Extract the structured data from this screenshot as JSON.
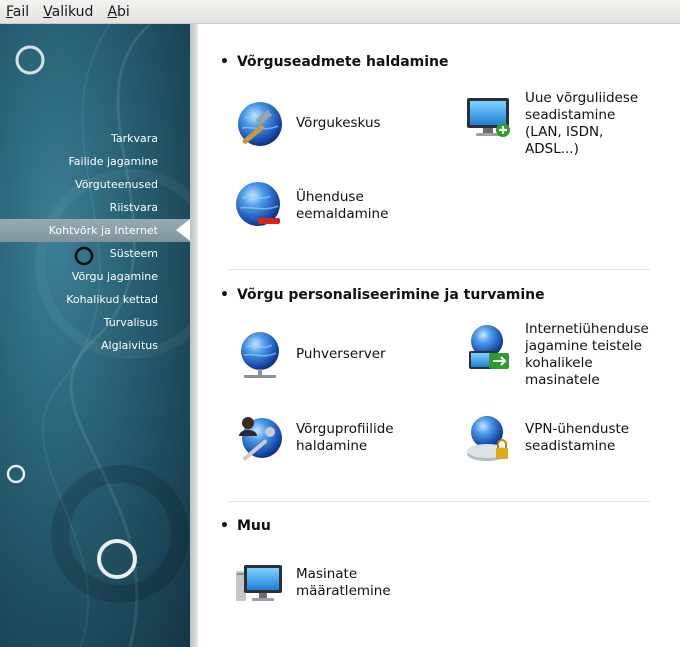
{
  "menubar": {
    "items": [
      {
        "mnemonic": "F",
        "rest": "ail"
      },
      {
        "mnemonic": "V",
        "rest": "alikud"
      },
      {
        "mnemonic": "A",
        "rest": "bi"
      }
    ]
  },
  "sidebar": {
    "items": [
      "Tarkvara",
      "Failide jagamine",
      "Võrguteenused",
      "Riistvara",
      "Kohtvõrk ja Internet",
      "Süsteem",
      "Võrgu jagamine",
      "Kohalikud kettad",
      "Turvalisus",
      "Alglaivitus"
    ],
    "active_index": 4
  },
  "sections": [
    {
      "title": "Võrguseadmete haldamine",
      "tools": [
        {
          "label": "Võrgukeskus",
          "icon": "network-center-icon"
        },
        {
          "label": "Uue võrguliidese\nseadistamine\n(LAN, ISDN,\nADSL...)",
          "icon": "new-interface-icon"
        },
        {
          "label": "Ühenduse\neemaldamine",
          "icon": "remove-connection-icon"
        }
      ]
    },
    {
      "title": "Võrgu personaliseerimine ja turvamine",
      "tools": [
        {
          "label": "Puhverserver",
          "icon": "proxy-icon"
        },
        {
          "label": "Internetiühenduse\njagamine teistele\nkohalikele\nmasinatele",
          "icon": "share-connection-icon"
        },
        {
          "label": "Võrguprofiilide\nhaldamine",
          "icon": "network-profiles-icon"
        },
        {
          "label": "VPN-ühenduste\nseadistamine",
          "icon": "vpn-icon"
        }
      ]
    },
    {
      "title": "Muu",
      "tools": [
        {
          "label": "Masinate\nmääratlemine",
          "icon": "hosts-icon"
        }
      ]
    }
  ],
  "colors": {
    "sidebar_dark": "#143646",
    "sidebar_light": "#3c7f96",
    "active_item": "#8a9ea8",
    "globe_blue": "#1f63c9"
  }
}
